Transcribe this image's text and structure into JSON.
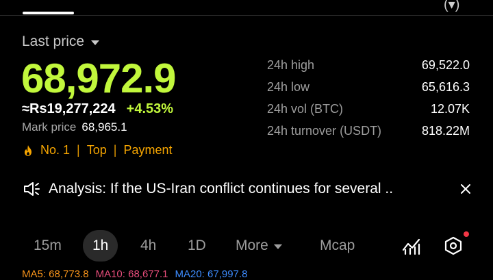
{
  "header": {
    "top_right_glyph": "(▾)"
  },
  "price_panel": {
    "label": "Last price",
    "price": "68,972.9",
    "approx_value": "≈Rs19,277,224",
    "change": "+4.53%",
    "mark_label": "Mark price",
    "mark_value": "68,965.1",
    "tags": [
      "No. 1",
      "Top",
      "Payment"
    ],
    "tag_separator": "|"
  },
  "stats": [
    {
      "label": "24h high",
      "value": "69,522.0"
    },
    {
      "label": "24h low",
      "value": "65,616.3"
    },
    {
      "label": "24h vol (BTC)",
      "value": "12.07K"
    },
    {
      "label": "24h turnover (USDT)",
      "value": "818.22M"
    }
  ],
  "news": {
    "text": "Analysis: If the US-Iran conflict continues for several .."
  },
  "intervals": {
    "items": [
      "15m",
      "1h",
      "4h",
      "1D",
      "More",
      "Mcap"
    ],
    "active": "1h"
  },
  "ma": [
    {
      "label": "MA5: 68,773.8",
      "color": "#f7931a"
    },
    {
      "label": "MA10: 68,677.1",
      "color": "#e84d7b"
    },
    {
      "label": "MA20: 67,997.8",
      "color": "#3d8bfd"
    }
  ],
  "colors": {
    "price_green": "#c1f73c",
    "change_green": "#c1f73c",
    "tag_orange": "#f7a600",
    "notification_red": "#f23645"
  },
  "icons": {
    "fire": "fire-icon",
    "speaker": "megaphone-icon",
    "close": "close-icon",
    "chart": "indicator-chart-icon",
    "settings": "hexagon-settings-icon"
  }
}
